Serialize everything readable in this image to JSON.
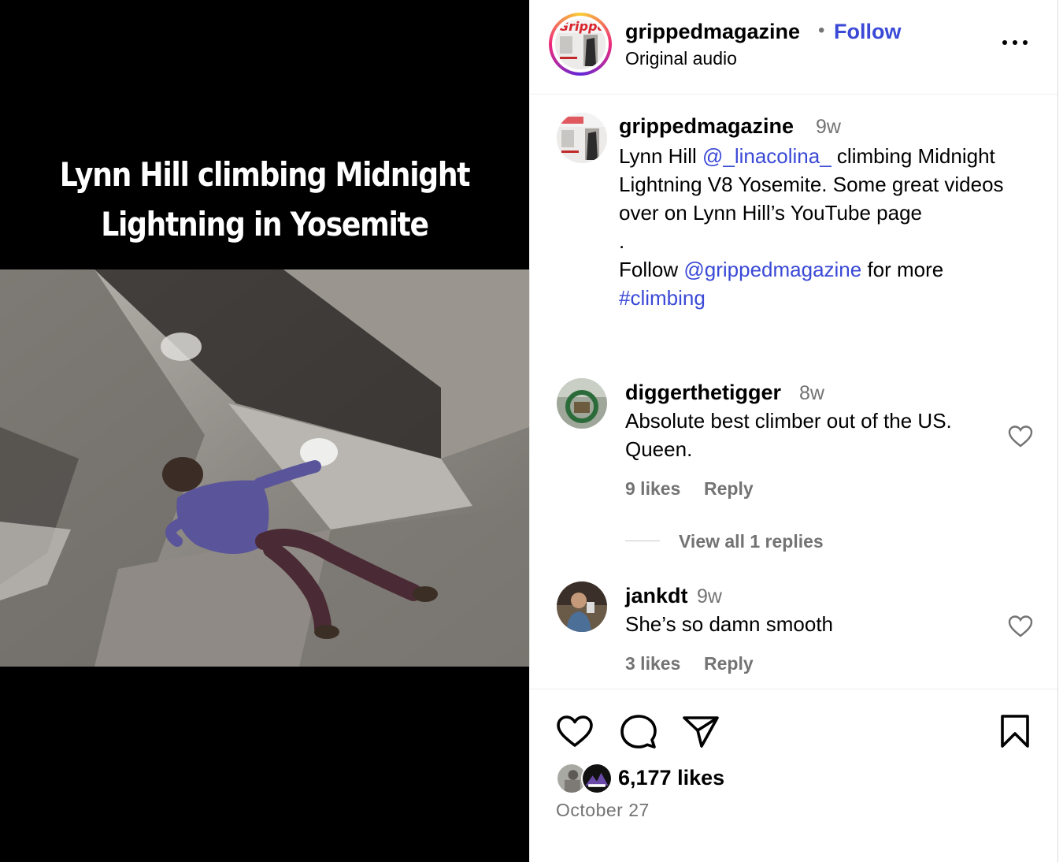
{
  "media": {
    "caption_line1": "Lynn Hill climbing Midnight",
    "caption_line2": "Lightning in Yosemite"
  },
  "header": {
    "username": "grippedmagazine",
    "separator": "•",
    "follow_label": "Follow",
    "audio": "Original audio",
    "avatar_text": "Gripped"
  },
  "caption": {
    "username": "grippedmagazine",
    "time": "9w",
    "text_1": "Lynn Hill ",
    "mention_1": "@_linacolina_",
    "text_2": " climbing Midnight Lightning V8 Yosemite. Some great videos over on Lynn Hill’s YouTube page",
    "dot": ".",
    "text_3": "Follow ",
    "mention_2": "@grippedmagazine",
    "text_4": " for more",
    "hashtag": "#climbing"
  },
  "comments": [
    {
      "username": "diggerthetigger",
      "time": "8w",
      "text": "Absolute best climber out of the US. Queen.",
      "likes": "9 likes",
      "reply_label": "Reply",
      "view_replies": "View all 1 replies"
    },
    {
      "username": "jankdt",
      "time": "9w",
      "text": "She’s so damn smooth",
      "likes": "3 likes",
      "reply_label": "Reply"
    }
  ],
  "footer": {
    "likes": "6,177 likes",
    "date": "October 27"
  },
  "icons": {
    "more": "more-options-icon",
    "like": "heart-icon",
    "comment": "comment-icon",
    "share": "share-icon",
    "save": "bookmark-icon"
  },
  "colors": {
    "link": "#3a49d6",
    "secondary_text": "#737373",
    "media_background": "#000000"
  }
}
